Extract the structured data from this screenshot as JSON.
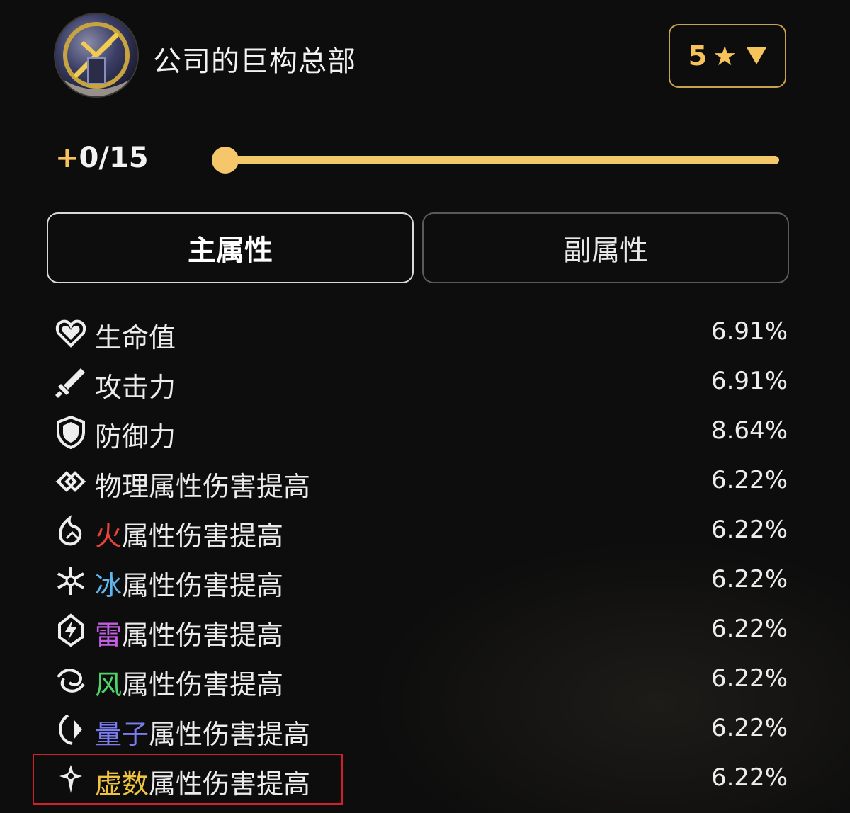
{
  "header": {
    "title": "公司的巨构总部",
    "rarity_value": "5",
    "rarity_star": "★"
  },
  "level": {
    "plus": "+",
    "text": "0/15",
    "progress": 0
  },
  "tabs": [
    {
      "label": "主属性",
      "active": true
    },
    {
      "label": "副属性",
      "active": false
    }
  ],
  "stats": [
    {
      "icon": "heart-icon",
      "prefix": "",
      "prefix_color": "",
      "label": "生命值",
      "value": "6.91%"
    },
    {
      "icon": "sword-icon",
      "prefix": "",
      "prefix_color": "",
      "label": "攻击力",
      "value": "6.91%"
    },
    {
      "icon": "shield-icon",
      "prefix": "",
      "prefix_color": "",
      "label": "防御力",
      "value": "8.64%"
    },
    {
      "icon": "physical-element-icon",
      "prefix": "",
      "prefix_color": "",
      "label": "物理属性伤害提高",
      "value": "6.22%"
    },
    {
      "icon": "fire-element-icon",
      "prefix": "火",
      "prefix_color": "#e8423b",
      "label": "属性伤害提高",
      "value": "6.22%"
    },
    {
      "icon": "ice-element-icon",
      "prefix": "冰",
      "prefix_color": "#5fb6ef",
      "label": "属性伤害提高",
      "value": "6.22%"
    },
    {
      "icon": "lightning-element-icon",
      "prefix": "雷",
      "prefix_color": "#c45ee3",
      "label": "属性伤害提高",
      "value": "6.22%"
    },
    {
      "icon": "wind-element-icon",
      "prefix": "风",
      "prefix_color": "#4fd36b",
      "label": "属性伤害提高",
      "value": "6.22%"
    },
    {
      "icon": "quantum-element-icon",
      "prefix": "量子",
      "prefix_color": "#7b7cf0",
      "label": "属性伤害提高",
      "value": "6.22%"
    },
    {
      "icon": "imaginary-element-icon",
      "prefix": "虚数",
      "prefix_color": "#f0c341",
      "label": "属性伤害提高",
      "value": "6.22%"
    }
  ],
  "colors": {
    "accent": "#f6c66a",
    "highlight_box": "#d21f2b"
  }
}
